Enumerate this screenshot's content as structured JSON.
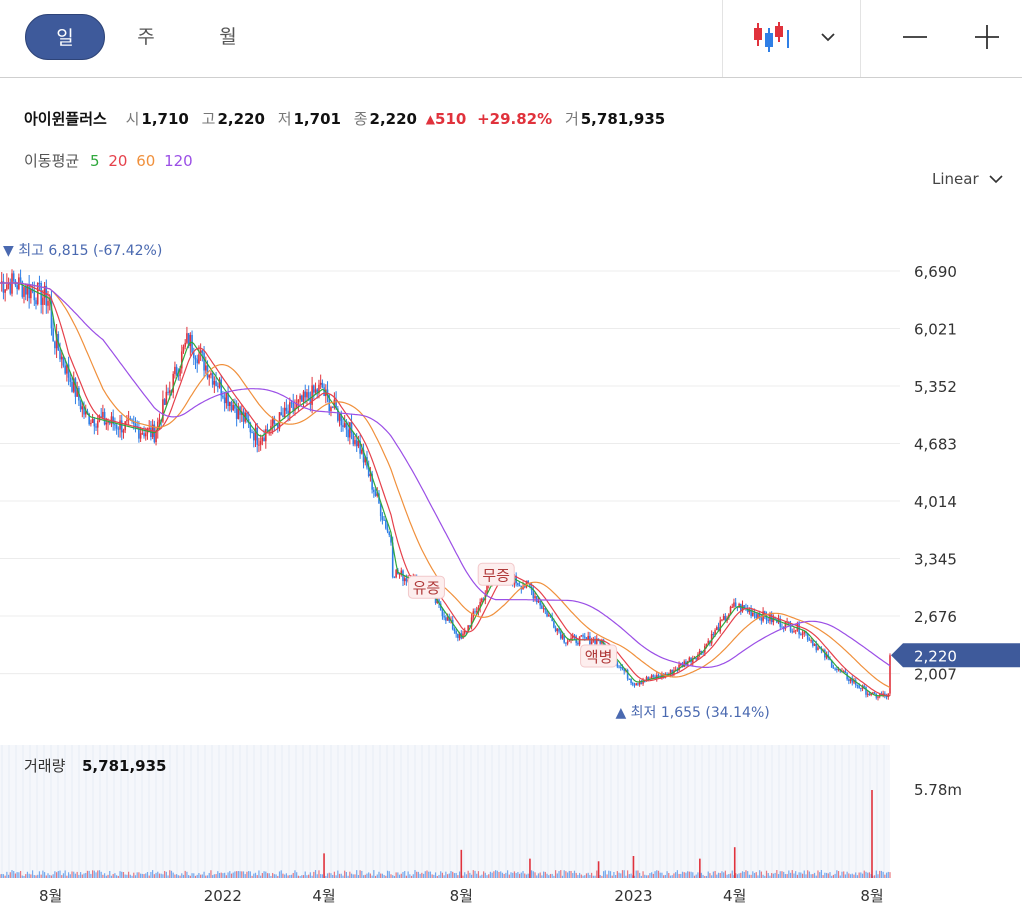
{
  "toolbar": {
    "periods": [
      "일",
      "주",
      "월"
    ],
    "active_period": "일",
    "chart_style_icon": "candlestick-icon",
    "dropdown_icon": "chevron-down-icon",
    "zoom_out_icon": "minus-icon",
    "zoom_in_icon": "plus-icon"
  },
  "info": {
    "name": "아이윈플러스",
    "open_label": "시",
    "open": "1,710",
    "high_label": "고",
    "high": "2,220",
    "low_label": "저",
    "low": "1,701",
    "close_label": "종",
    "close": "2,220",
    "change": "510",
    "change_pct": "+29.82%",
    "volume_label": "거",
    "volume": "5,781,935"
  },
  "ma": {
    "label": "이동평균",
    "periods": [
      "5",
      "20",
      "60",
      "120"
    ],
    "colors": [
      "#2fa83c",
      "#e5414b",
      "#f0903c",
      "#9b4fe6"
    ]
  },
  "scale": {
    "label": "Linear"
  },
  "colors": {
    "up": "#e0323c",
    "down": "#2f7fe6",
    "accent": "#3e5a9b",
    "ann_text": "#4a69b0",
    "grid": "#ececec"
  },
  "chart_data": {
    "type": "candlestick",
    "y_ticks": [
      "6,690",
      "6,021",
      "5,352",
      "4,683",
      "4,014",
      "3,345",
      "2,676",
      "2,007"
    ],
    "ylim": [
      1560,
      7050
    ],
    "x_ticks": [
      "8월",
      "2022",
      "4월",
      "8월",
      "2023",
      "4월",
      "8월"
    ],
    "x_tick_dates": [
      "2021-08",
      "2022-01",
      "2022-04",
      "2022-08",
      "2023-01",
      "2023-04",
      "2023-08"
    ],
    "date_range": [
      "2021-07",
      "2023-08"
    ],
    "current_price": "2,220",
    "max_marker": {
      "label": "최고",
      "value": "6,815",
      "pct": "(-67.42%)"
    },
    "min_marker": {
      "label": "최저",
      "value": "1,655",
      "pct": "(34.14%)"
    },
    "events": [
      "유증",
      "무증",
      "액병"
    ],
    "price_path": [
      [
        "2021-07",
        6550
      ],
      [
        "2021-08",
        6350
      ],
      [
        "2021-08",
        6000
      ],
      [
        "2021-09",
        5000
      ],
      [
        "2021-10",
        4900
      ],
      [
        "2021-11",
        4800
      ],
      [
        "2021-12",
        5900
      ],
      [
        "2022-01",
        5300
      ],
      [
        "2022-02",
        4750
      ],
      [
        "2022-03",
        5050
      ],
      [
        "2022-04",
        5350
      ],
      [
        "2022-04",
        5250
      ],
      [
        "2022-05",
        4700
      ],
      [
        "2022-06",
        3500
      ],
      [
        "2022-06",
        3200
      ],
      [
        "2022-07",
        3000
      ],
      [
        "2022-08",
        2400
      ],
      [
        "2022-09",
        3200
      ],
      [
        "2022-10",
        3000
      ],
      [
        "2022-11",
        2400
      ],
      [
        "2022-12",
        2400
      ],
      [
        "2023-01",
        1900
      ],
      [
        "2023-02",
        2000
      ],
      [
        "2023-03",
        2250
      ],
      [
        "2023-04",
        2800
      ],
      [
        "2023-05",
        2650
      ],
      [
        "2023-06",
        2500
      ],
      [
        "2023-07",
        2050
      ],
      [
        "2023-08",
        1750
      ],
      [
        "2023-08",
        2220
      ]
    ],
    "volume": {
      "label": "거래량",
      "value": "5,781,935",
      "tick": "5.78m",
      "spikes": [
        [
          "2022-04",
          0.28
        ],
        [
          "2022-08",
          0.32
        ],
        [
          "2022-10",
          0.22
        ],
        [
          "2022-12",
          0.19
        ],
        [
          "2023-01",
          0.25
        ],
        [
          "2023-03",
          0.22
        ],
        [
          "2023-04",
          0.35
        ],
        [
          "2023-08",
          1.0
        ]
      ]
    }
  }
}
